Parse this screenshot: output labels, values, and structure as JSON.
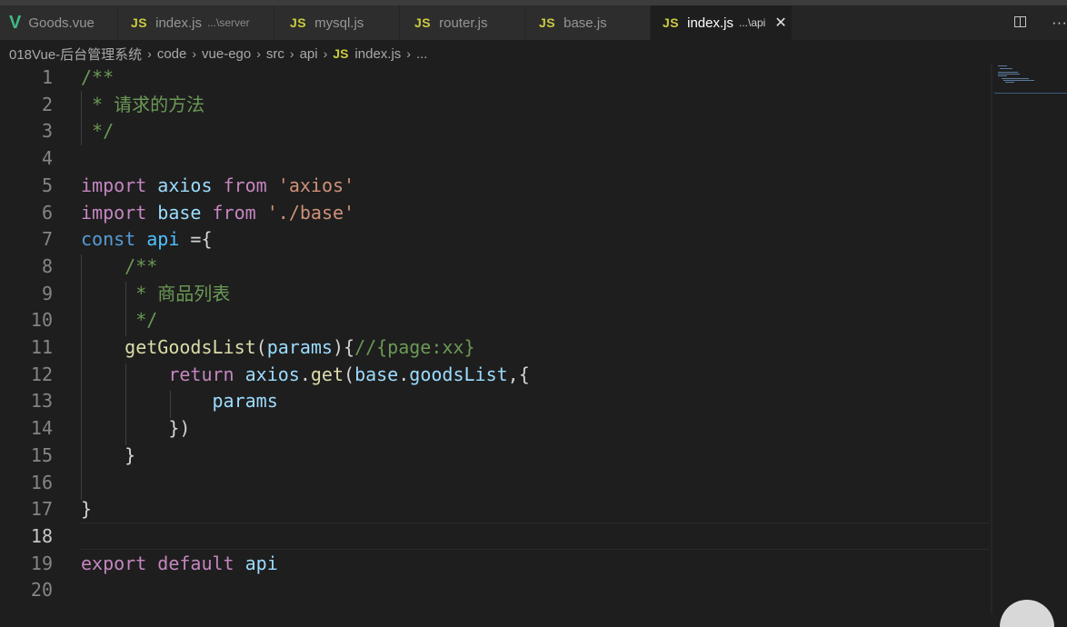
{
  "tabs": [
    {
      "icon": "vue-icon",
      "glyph": "V",
      "label": "Goods.vue",
      "suffix": "",
      "active": false
    },
    {
      "icon": "js-icon",
      "glyph": "JS",
      "label": "index.js",
      "suffix": "...\\server",
      "active": false
    },
    {
      "icon": "js-icon",
      "glyph": "JS",
      "label": "mysql.js",
      "suffix": "",
      "active": false
    },
    {
      "icon": "js-icon",
      "glyph": "JS",
      "label": "router.js",
      "suffix": "",
      "active": false
    },
    {
      "icon": "js-icon",
      "glyph": "JS",
      "label": "base.js",
      "suffix": "",
      "active": false
    },
    {
      "icon": "js-icon",
      "glyph": "JS",
      "label": "index.js",
      "suffix": "...\\api",
      "active": true
    }
  ],
  "tab_close_glyph": "✕",
  "tab_actions": {
    "more_glyph": "···"
  },
  "breadcrumb": {
    "items": [
      "018Vue-后台管理系统",
      "code",
      "vue-ego",
      "src",
      "api"
    ],
    "file_icon": "JS",
    "file": "index.js",
    "tail": "..."
  },
  "editor": {
    "current_line": 18,
    "lines": [
      {
        "n": "1",
        "tokens": [
          [
            "cm",
            "/**"
          ]
        ]
      },
      {
        "n": "2",
        "tokens": [
          [
            "cm",
            " * 请求的方法"
          ]
        ]
      },
      {
        "n": "3",
        "tokens": [
          [
            "cm",
            " */"
          ]
        ]
      },
      {
        "n": "4",
        "tokens": []
      },
      {
        "n": "5",
        "tokens": [
          [
            "kw",
            "import"
          ],
          [
            "",
            " "
          ],
          [
            "var",
            "axios"
          ],
          [
            "",
            " "
          ],
          [
            "kw",
            "from"
          ],
          [
            "",
            " "
          ],
          [
            "str",
            "'axios'"
          ]
        ]
      },
      {
        "n": "6",
        "tokens": [
          [
            "kw",
            "import"
          ],
          [
            "",
            " "
          ],
          [
            "var",
            "base"
          ],
          [
            "",
            " "
          ],
          [
            "kw",
            "from"
          ],
          [
            "",
            " "
          ],
          [
            "str",
            "'./base'"
          ]
        ]
      },
      {
        "n": "7",
        "tokens": [
          [
            "dc",
            "const"
          ],
          [
            "",
            " "
          ],
          [
            "cst",
            "api"
          ],
          [
            "",
            " ={"
          ]
        ]
      },
      {
        "n": "8",
        "tokens": [
          [
            "",
            "    "
          ],
          [
            "cm",
            "/**"
          ]
        ]
      },
      {
        "n": "9",
        "tokens": [
          [
            "",
            "    "
          ],
          [
            "cm",
            " * 商品列表"
          ]
        ]
      },
      {
        "n": "10",
        "tokens": [
          [
            "",
            "    "
          ],
          [
            "cm",
            " */"
          ]
        ]
      },
      {
        "n": "11",
        "tokens": [
          [
            "",
            "    "
          ],
          [
            "fn",
            "getGoodsList"
          ],
          [
            "",
            "("
          ],
          [
            "var",
            "params"
          ],
          [
            "",
            "){"
          ],
          [
            "cm",
            "//{page:xx}"
          ]
        ]
      },
      {
        "n": "12",
        "tokens": [
          [
            "",
            "        "
          ],
          [
            "kw",
            "return"
          ],
          [
            "",
            " "
          ],
          [
            "var",
            "axios"
          ],
          [
            "",
            "."
          ],
          [
            "fn",
            "get"
          ],
          [
            "",
            "("
          ],
          [
            "var",
            "base"
          ],
          [
            "",
            "."
          ],
          [
            "var",
            "goodsList"
          ],
          [
            "",
            ",{"
          ]
        ]
      },
      {
        "n": "13",
        "tokens": [
          [
            "",
            "            "
          ],
          [
            "var",
            "params"
          ]
        ]
      },
      {
        "n": "14",
        "tokens": [
          [
            "",
            "        "
          ],
          [
            "",
            "})"
          ]
        ]
      },
      {
        "n": "15",
        "tokens": [
          [
            "",
            "    "
          ],
          [
            "",
            "}"
          ]
        ]
      },
      {
        "n": "16",
        "tokens": []
      },
      {
        "n": "17",
        "tokens": [
          [
            "",
            "}"
          ]
        ]
      },
      {
        "n": "18",
        "tokens": []
      },
      {
        "n": "19",
        "tokens": [
          [
            "kw",
            "export"
          ],
          [
            "",
            " "
          ],
          [
            "kw",
            "default"
          ],
          [
            "",
            " "
          ],
          [
            "var",
            "api"
          ]
        ]
      },
      {
        "n": "20",
        "tokens": []
      }
    ]
  }
}
